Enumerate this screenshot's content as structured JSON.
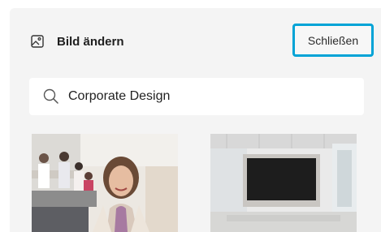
{
  "header": {
    "title": "Bild ändern",
    "icon": "image-icon",
    "close_label": "Schließen"
  },
  "search": {
    "value": "Corporate Design",
    "icon": "search-icon"
  },
  "results": [
    {
      "name": "office-portrait-image"
    },
    {
      "name": "empty-office-screen-image"
    }
  ],
  "colors": {
    "accent": "#00a3d6",
    "panel_bg": "#f4f4f4"
  }
}
